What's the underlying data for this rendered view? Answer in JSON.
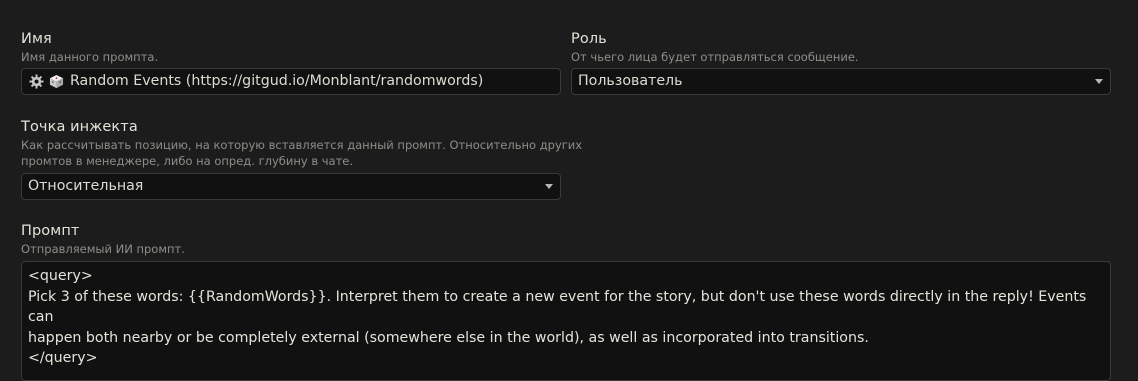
{
  "name_section": {
    "label": "Имя",
    "hint": "Имя данного промпта.",
    "value": "Random Events (https://gitgud.io/Monblant/randomwords)",
    "icons": [
      "gear-icon",
      "dice-icon"
    ]
  },
  "role_section": {
    "label": "Роль",
    "hint": "От чьего лица будет отправляться сообщение.",
    "selected": "Пользователь"
  },
  "injection_section": {
    "label": "Точка инжекта",
    "hint_line1": "Как рассчитывать позицию, на которую вставляется данный промпт. Относительно других",
    "hint_line2": "промтов в менеджере, либо на опред. глубину в чате.",
    "selected": "Относительная"
  },
  "prompt_section": {
    "label": "Промпт",
    "hint": "Отправляемый ИИ промпт.",
    "lines": [
      "<query>",
      "Pick 3 of these words: {{RandomWords}}. Interpret them to create a new event for the story, but don't use these words directly in the reply! Events can",
      "happen both nearby or be completely external (somewhere else in the world), as well as incorporated into transitions.",
      "</query>"
    ]
  }
}
